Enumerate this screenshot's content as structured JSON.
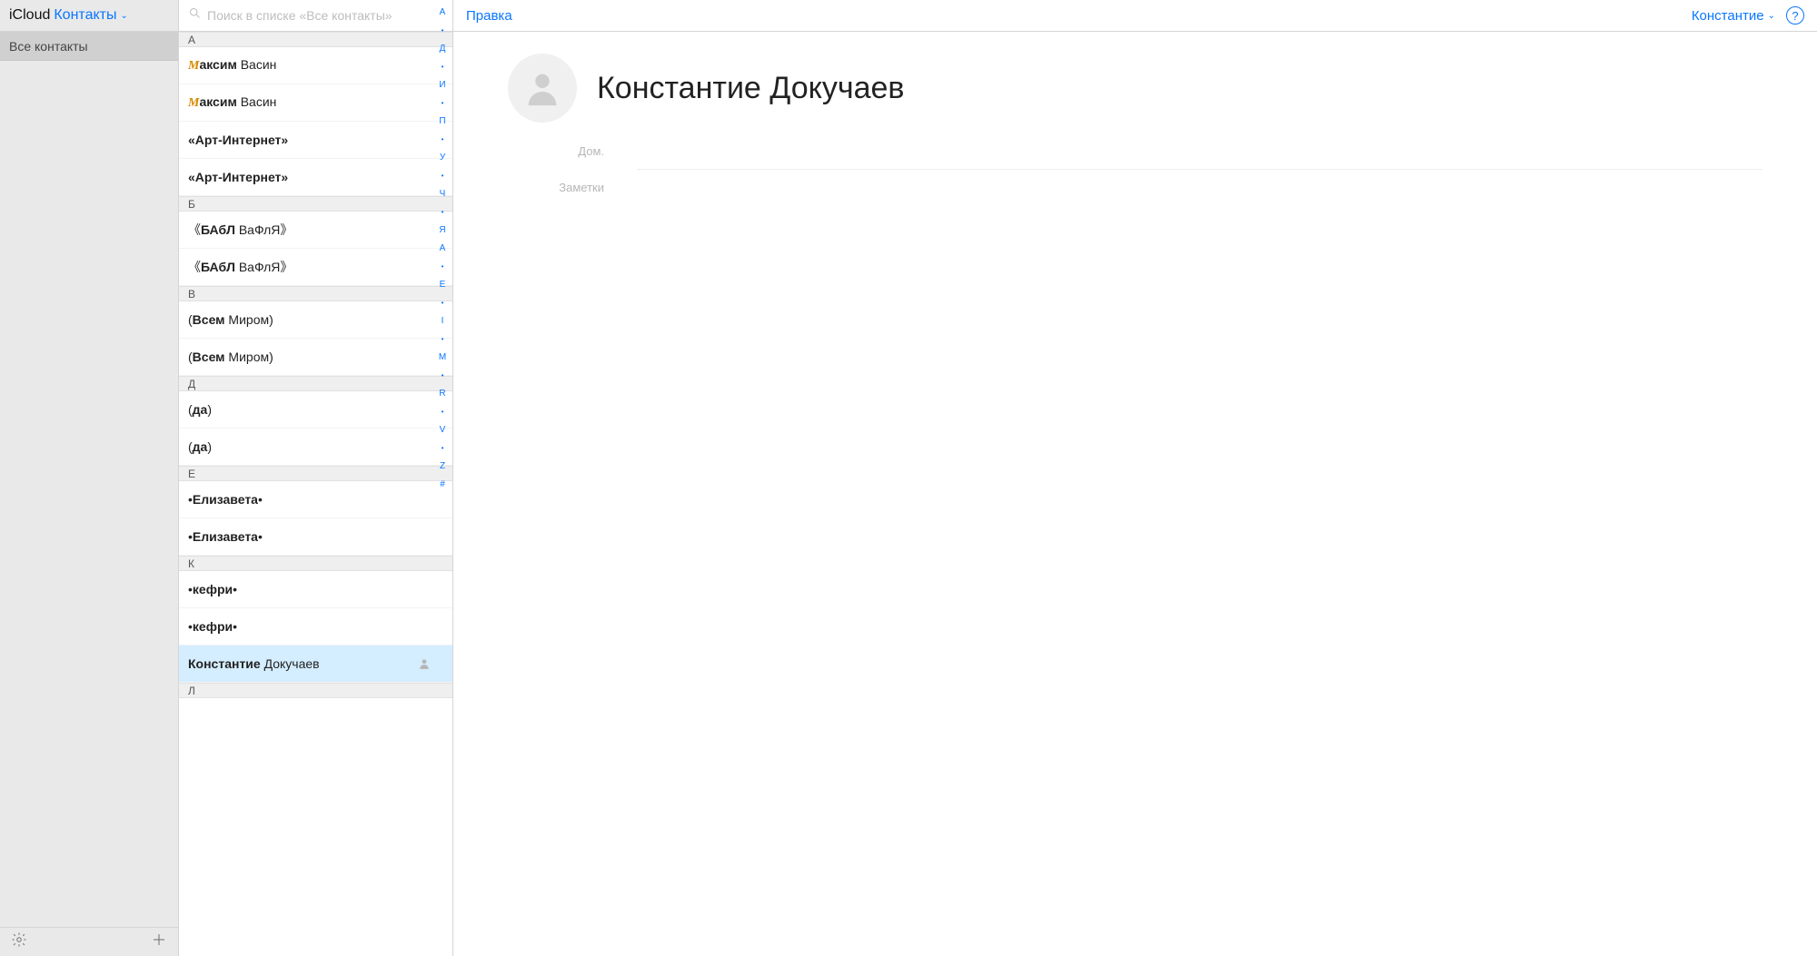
{
  "sidebar": {
    "brand": "iCloud",
    "dropdown_label": "Контакты",
    "group_label": "Все контакты",
    "gear_icon": "gear",
    "add_icon": "plus"
  },
  "search": {
    "placeholder": "Поиск в списке «Все контакты»"
  },
  "sections": [
    {
      "letter": "А",
      "items": [
        {
          "html": "<span class='mc'>М</span><b>аксим</b> Васин"
        },
        {
          "html": "<span class='mc'>М</span><b>аксим</b> Васин"
        },
        {
          "html": "<b>«Арт-Интернет»</b>"
        },
        {
          "html": "<b>«Арт-Интернет»</b>"
        }
      ]
    },
    {
      "letter": "Б",
      "items": [
        {
          "html": "《<b>БАбЛ</b> ВаФлЯ》"
        },
        {
          "html": "《<b>БАбЛ</b> ВаФлЯ》"
        }
      ]
    },
    {
      "letter": "В",
      "items": [
        {
          "html": "(<b>Всем</b> Миром)"
        },
        {
          "html": "(<b>Всем</b> Миром)"
        }
      ]
    },
    {
      "letter": "Д",
      "items": [
        {
          "html": "(<b>да</b>)"
        },
        {
          "html": "(<b>да</b>)"
        }
      ]
    },
    {
      "letter": "Е",
      "items": [
        {
          "html": "•<b>Елизавета</b>•"
        },
        {
          "html": "•<b>Елизавета</b>•"
        }
      ]
    },
    {
      "letter": "К",
      "items": [
        {
          "html": "•<b>кефри</b>•"
        },
        {
          "html": "•<b>кефри</b>•"
        },
        {
          "html": "<b>Константие</b> Докучаев",
          "selected": true,
          "silhouette": true
        }
      ]
    },
    {
      "letter": "Л",
      "items": []
    }
  ],
  "alpha_index": [
    "А",
    "•",
    "Д",
    "•",
    "И",
    "•",
    "П",
    "•",
    "У",
    "•",
    "Ч",
    "•",
    "Я",
    "A",
    "•",
    "E",
    "•",
    "I",
    "•",
    "M",
    "•",
    "R",
    "•",
    "V",
    "•",
    "Z",
    "#"
  ],
  "header": {
    "edit_label": "Правка",
    "user_label": "Константие",
    "help_icon": "?"
  },
  "card": {
    "full_name": "Константие Докучаев",
    "field_home_label": "Дом.",
    "field_home_value": "",
    "field_notes_label": "Заметки",
    "field_notes_value": ""
  }
}
